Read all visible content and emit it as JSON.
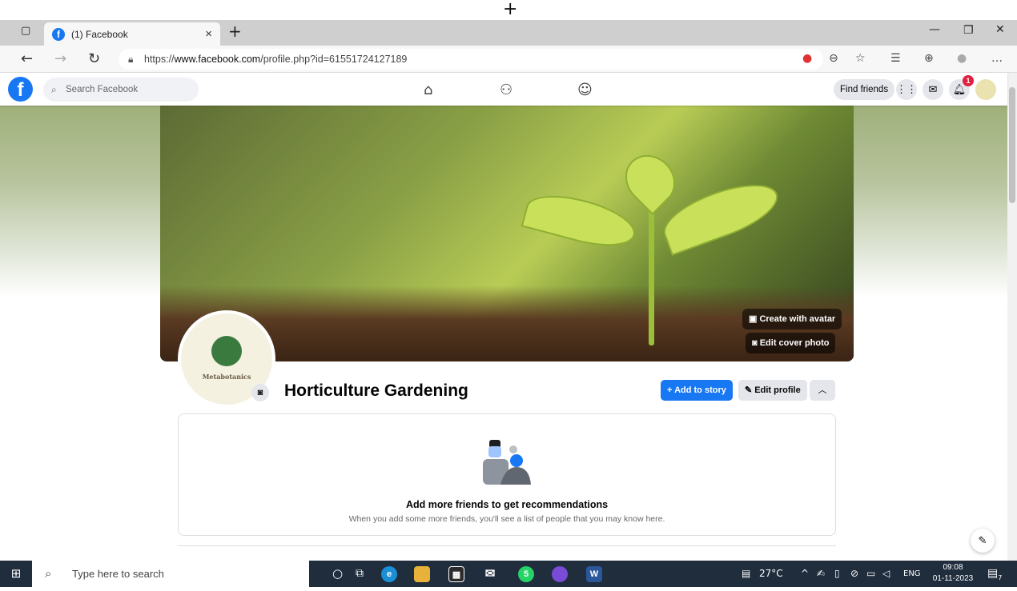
{
  "browser": {
    "tab_title": "(1) Facebook",
    "tab_close": "×",
    "new_tab": "+",
    "url_prefix": "https://",
    "url_domain": "www.facebook.com",
    "url_path": "/profile.php?id=61551724127189"
  },
  "facebook": {
    "logo": "f",
    "search_placeholder": "Search Facebook",
    "find_friends": "Find friends",
    "notification_count": "1"
  },
  "profile": {
    "brand_text": "Metabotanics",
    "name": "Horticulture Gardening",
    "create_with_avatar": "Create with avatar",
    "edit_cover_photo": "Edit cover photo",
    "add_to_story": "+ Add to story",
    "edit_profile": "Edit profile"
  },
  "recommendations": {
    "heading": "Add more friends to get recommendations",
    "subtext": "When you add some more friends, you'll see a list of people that you may know here."
  },
  "taskbar": {
    "search_placeholder": "Type here to search",
    "temperature": "27°C",
    "language": "ENG",
    "time": "09:08",
    "date": "01-11-2023",
    "whatsapp_badge": "5",
    "notifications_badge": "7"
  }
}
